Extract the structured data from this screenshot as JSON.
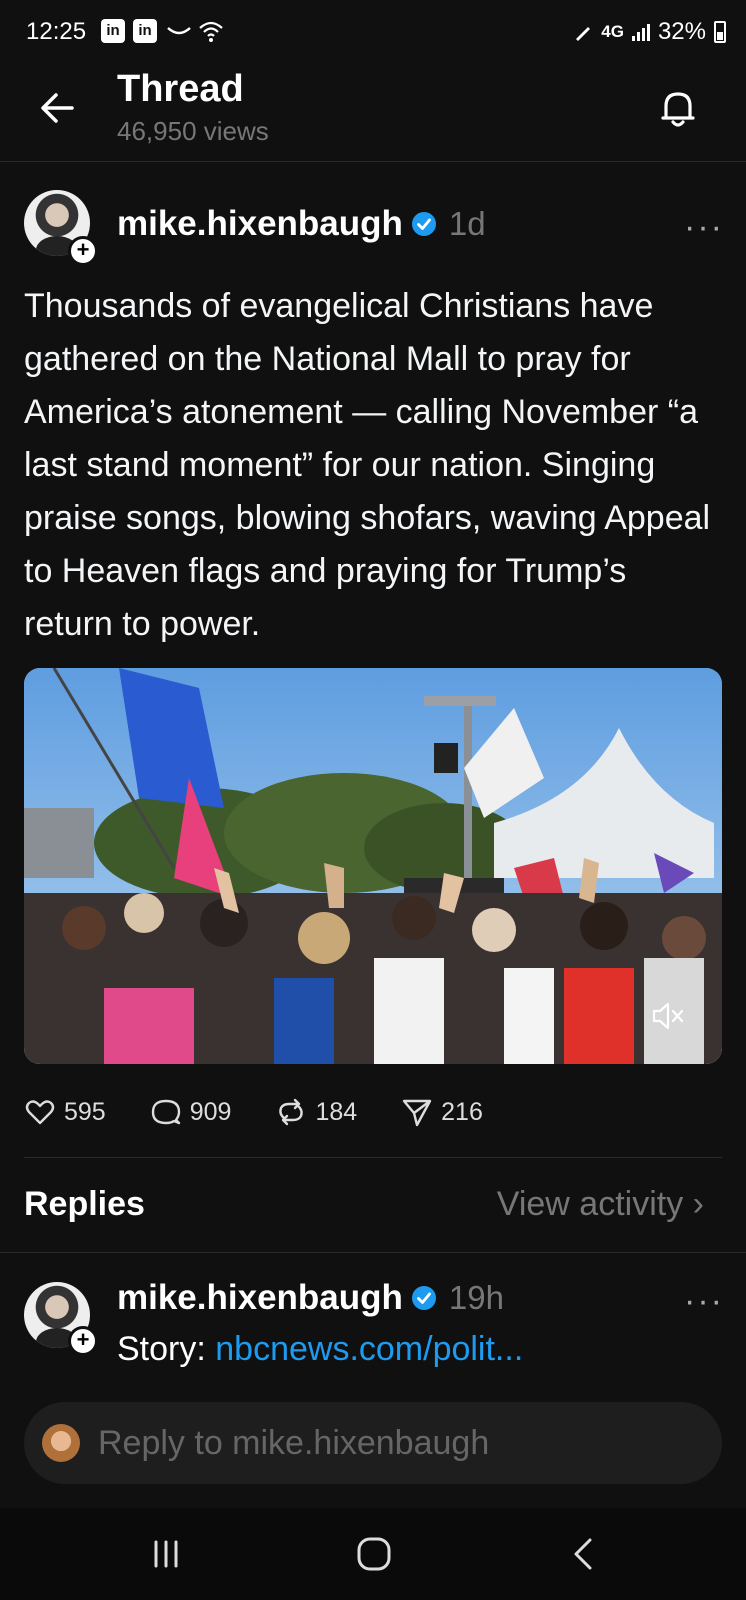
{
  "status_bar": {
    "time": "12:25",
    "network": "4G",
    "battery": "32%"
  },
  "header": {
    "title": "Thread",
    "views": "46,950 views"
  },
  "post": {
    "author": "mike.hixenbaugh",
    "time_ago": "1d",
    "text": "Thousands of evangelical Christians have gathered on the National Mall to pray for America’s atonement — calling November “a last stand moment” for our nation. Singing praise songs, blowing shofars, waving Appeal to Heaven flags and praying for Trump’s return to power.",
    "likes": "595",
    "comments": "909",
    "reposts": "184",
    "shares": "216"
  },
  "replies_section": {
    "title": "Replies",
    "view_activity": "View activity ›"
  },
  "reply": {
    "author": "mike.hixenbaugh",
    "time_ago": "19h",
    "prefix": "Story: ",
    "link": "nbcnews.com/polit..."
  },
  "composer": {
    "placeholder": "Reply to mike.hixenbaugh"
  },
  "colors": {
    "background": "#101010",
    "link": "#1d9bf0",
    "verified": "#1d9bf0"
  }
}
